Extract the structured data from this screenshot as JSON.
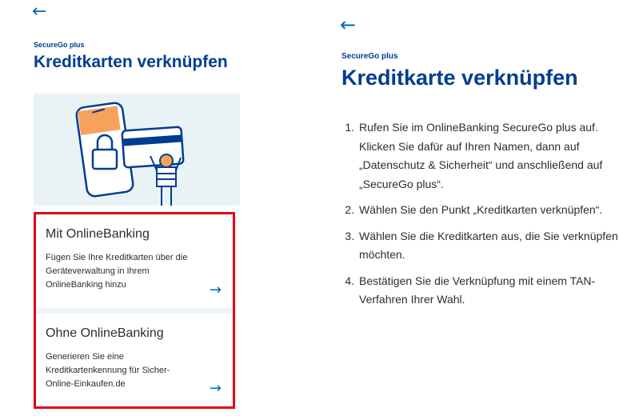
{
  "left": {
    "back_icon": "←",
    "brand": "SecureGo plus",
    "title": "Kreditkarten verknüpfen",
    "cards": [
      {
        "title": "Mit OnlineBanking",
        "text": "Fügen Sie Ihre Kreditkarten über die Geräteverwaltung in Ihrem OnlineBanking hinzu",
        "arrow": "→"
      },
      {
        "title": "Ohne OnlineBanking",
        "text": "Generieren Sie eine Kreditkartenkennung für Sicher-Online-Einkaufen.de",
        "arrow": "→"
      }
    ]
  },
  "right": {
    "back_icon": "←",
    "brand": "SecureGo plus",
    "title": "Kreditkarte verknüpfen",
    "steps": [
      "Rufen Sie im OnlineBanking SecureGo plus auf. Klicken Sie dafür auf Ihren Namen, dann auf „Datenschutz & Sicherheit“ und anschließend auf „SecureGo plus“.",
      "Wählen Sie den Punkt „Kreditkarten verknüpfen“.",
      "Wählen Sie die Kreditkarten aus, die Sie verknüpfen möchten.",
      "Bestätigen Sie die Verknüpfung mit einem TAN-Verfahren Ihrer Wahl."
    ]
  },
  "colors": {
    "brand_blue": "#003d8f",
    "link_blue": "#0066b3",
    "highlight_red": "#e2001a",
    "illustration_bg": "#e9f3f6",
    "accent_orange": "#f7a25c"
  }
}
